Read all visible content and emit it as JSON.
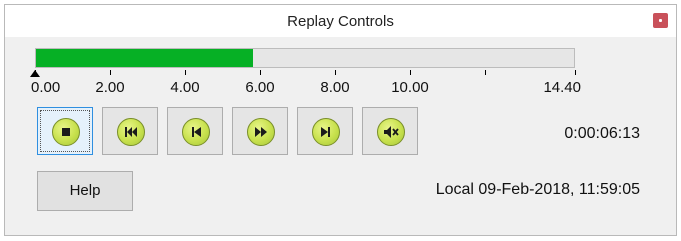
{
  "window": {
    "title": "Replay Controls"
  },
  "progress": {
    "value": 5.8,
    "max": 14.4,
    "color": "#06b025"
  },
  "timeline": {
    "ticks": [
      0.0,
      2.0,
      4.0,
      6.0,
      8.0,
      10.0,
      12.0,
      14.4
    ],
    "labels": [
      {
        "value": 0.0,
        "text": "0.00"
      },
      {
        "value": 2.0,
        "text": "2.00"
      },
      {
        "value": 4.0,
        "text": "4.00"
      },
      {
        "value": 6.0,
        "text": "6.00"
      },
      {
        "value": 8.0,
        "text": "8.00"
      },
      {
        "value": 10.0,
        "text": "10.00"
      },
      {
        "value": 14.4,
        "text": "14.40"
      }
    ],
    "marker_value": 0.0
  },
  "controls": [
    {
      "name": "stop-button",
      "icon": "stop-icon",
      "focused": true
    },
    {
      "name": "skip-to-start-button",
      "icon": "skip-to-start-icon",
      "focused": false
    },
    {
      "name": "step-back-button",
      "icon": "step-back-icon",
      "focused": false
    },
    {
      "name": "fast-forward-button",
      "icon": "fast-forward-icon",
      "focused": false
    },
    {
      "name": "step-forward-button",
      "icon": "step-forward-icon",
      "focused": false
    },
    {
      "name": "mute-button",
      "icon": "speaker-muted-icon",
      "focused": false
    }
  ],
  "status": {
    "elapsed": "0:00:06:13",
    "datetime": "Local 09-Feb-2018, 11:59:05"
  },
  "buttons": {
    "help": "Help"
  }
}
